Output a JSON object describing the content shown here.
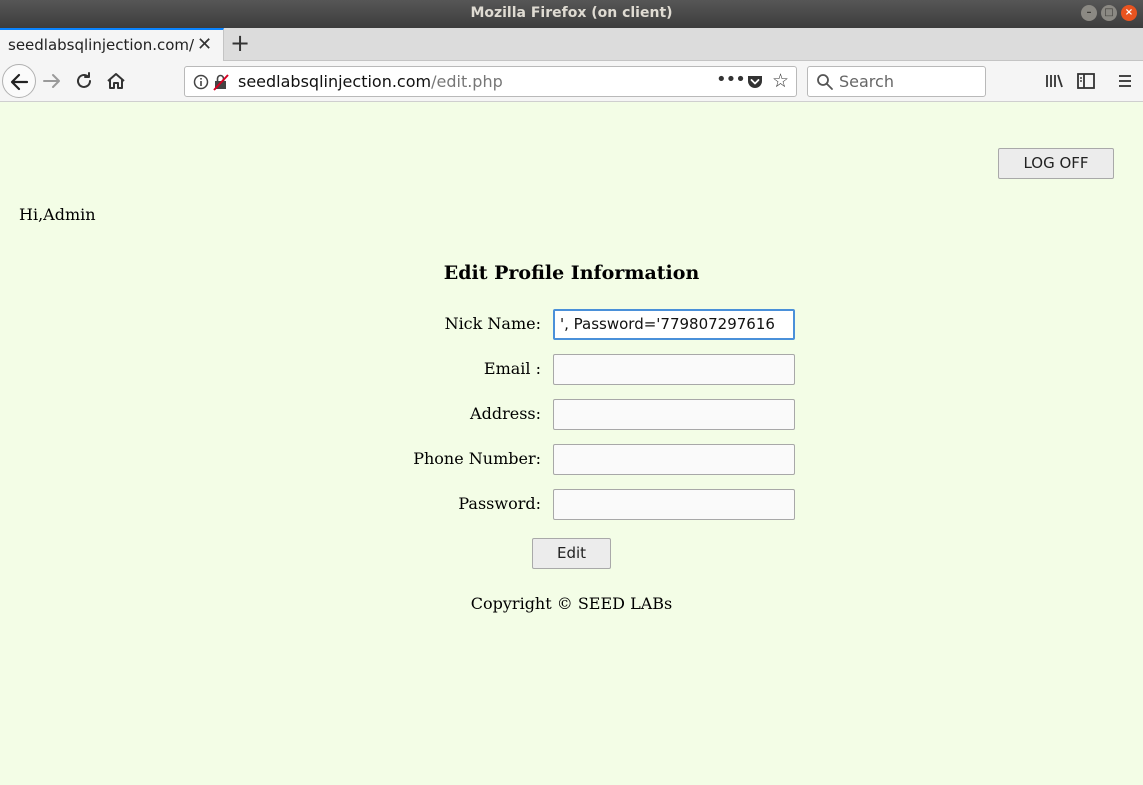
{
  "window": {
    "title": "Mozilla Firefox (on client)"
  },
  "tab": {
    "title": "seedlabsqlinjection.com/edit.php"
  },
  "urlbar": {
    "host": "seedlabsqlinjection.com",
    "path": "/edit.php"
  },
  "search": {
    "placeholder": "Search"
  },
  "page": {
    "logoff_label": "LOG OFF",
    "greeting": "Hi,Admin",
    "heading": "Edit Profile Information",
    "fields": [
      {
        "label": "Nick Name:",
        "value": "', Password='779807297616"
      },
      {
        "label": "Email :",
        "value": ""
      },
      {
        "label": "Address:",
        "value": ""
      },
      {
        "label": "Phone Number:",
        "value": ""
      },
      {
        "label": "Password:",
        "value": ""
      }
    ],
    "edit_label": "Edit",
    "copyright": "Copyright © SEED LABs"
  }
}
